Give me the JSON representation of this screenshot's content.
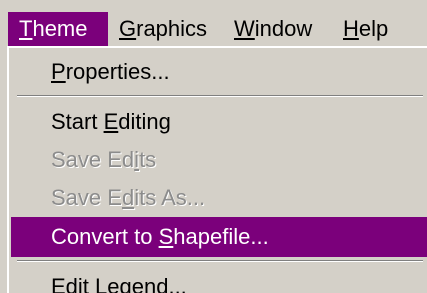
{
  "menubar": {
    "items": [
      {
        "pre": "",
        "key": "T",
        "post": "heme"
      },
      {
        "pre": "",
        "key": "G",
        "post": "raphics"
      },
      {
        "pre": "",
        "key": "W",
        "post": "indow"
      },
      {
        "pre": "",
        "key": "H",
        "post": "elp"
      }
    ],
    "active_item": "Theme"
  },
  "menu": {
    "items": [
      {
        "pre": "",
        "key": "P",
        "post": "roperties..."
      },
      {
        "pre": "Start ",
        "key": "E",
        "post": "diting"
      },
      {
        "pre": "Save Ed",
        "key": "i",
        "post": "ts"
      },
      {
        "pre": "Save E",
        "key": "d",
        "post": "its As..."
      },
      {
        "pre": "Convert to ",
        "key": "S",
        "post": "hapefile..."
      },
      {
        "pre": "Edit ",
        "key": "L",
        "post": "egend..."
      }
    ]
  },
  "colors": {
    "menu_background": "#d4d0c8",
    "highlight": "#7b007b",
    "highlight_text": "#ffffff",
    "disabled_text": "#8c8c8c"
  }
}
